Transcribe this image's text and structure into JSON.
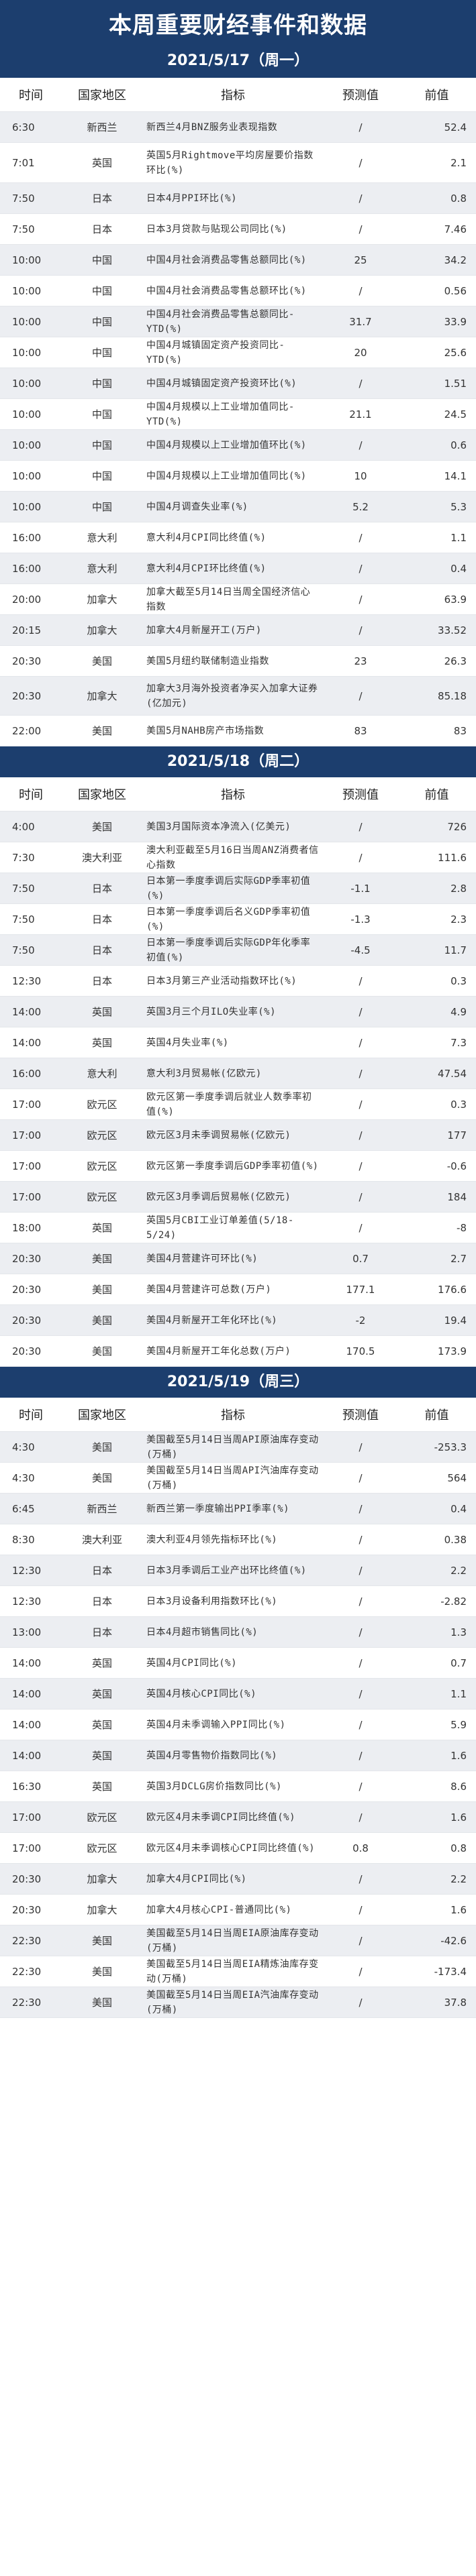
{
  "title": "本周重要财经事件和数据",
  "columns": [
    "时间",
    "国家地区",
    "指标",
    "预测值",
    "前值"
  ],
  "days": [
    {
      "date": "2021/5/17（周一）",
      "rows": [
        {
          "time": "6:30",
          "region": "新西兰",
          "indicator": "新西兰4月BNZ服务业表现指数",
          "forecast": "/",
          "prev": "52.4",
          "h": 46
        },
        {
          "time": "7:01",
          "region": "英国",
          "indicator": "英国5月Rightmove平均房屋要价指数环比(%)",
          "forecast": "/",
          "prev": "2.1",
          "h": 60
        },
        {
          "time": "7:50",
          "region": "日本",
          "indicator": "日本4月PPI环比(%)",
          "forecast": "/",
          "prev": "0.8",
          "h": 46
        },
        {
          "time": "7:50",
          "region": "日本",
          "indicator": "日本3月贷款与贴现公司同比(%)",
          "forecast": "/",
          "prev": "7.46",
          "h": 46
        },
        {
          "time": "10:00",
          "region": "中国",
          "indicator": "中国4月社会消费品零售总额同比(%)",
          "forecast": "25",
          "prev": "34.2",
          "h": 46
        },
        {
          "time": "10:00",
          "region": "中国",
          "indicator": "中国4月社会消费品零售总额环比(%)",
          "forecast": "/",
          "prev": "0.56",
          "h": 46
        },
        {
          "time": "10:00",
          "region": "中国",
          "indicator": "中国4月社会消费品零售总额同比-YTD(%)",
          "forecast": "31.7",
          "prev": "33.9",
          "h": 46
        },
        {
          "time": "10:00",
          "region": "中国",
          "indicator": "中国4月城镇固定资产投资同比-YTD(%)",
          "forecast": "20",
          "prev": "25.6",
          "h": 46
        },
        {
          "time": "10:00",
          "region": "中国",
          "indicator": "中国4月城镇固定资产投资环比(%)",
          "forecast": "/",
          "prev": "1.51",
          "h": 46
        },
        {
          "time": "10:00",
          "region": "中国",
          "indicator": "中国4月规模以上工业增加值同比-YTD(%)",
          "forecast": "21.1",
          "prev": "24.5",
          "h": 46
        },
        {
          "time": "10:00",
          "region": "中国",
          "indicator": "中国4月规模以上工业增加值环比(%)",
          "forecast": "/",
          "prev": "0.6",
          "h": 46
        },
        {
          "time": "10:00",
          "region": "中国",
          "indicator": "中国4月规模以上工业增加值同比(%)",
          "forecast": "10",
          "prev": "14.1",
          "h": 46
        },
        {
          "time": "10:00",
          "region": "中国",
          "indicator": "中国4月调查失业率(%)",
          "forecast": "5.2",
          "prev": "5.3",
          "h": 46
        },
        {
          "time": "16:00",
          "region": "意大利",
          "indicator": "意大利4月CPI同比终值(%)",
          "forecast": "/",
          "prev": "1.1",
          "h": 46
        },
        {
          "time": "16:00",
          "region": "意大利",
          "indicator": "意大利4月CPI环比终值(%)",
          "forecast": "/",
          "prev": "0.4",
          "h": 46
        },
        {
          "time": "20:00",
          "region": "加拿大",
          "indicator": "加拿大截至5月14日当周全国经济信心指数",
          "forecast": "/",
          "prev": "63.9",
          "h": 46
        },
        {
          "time": "20:15",
          "region": "加拿大",
          "indicator": "加拿大4月新屋开工(万户)",
          "forecast": "/",
          "prev": "33.52",
          "h": 46
        },
        {
          "time": "20:30",
          "region": "美国",
          "indicator": "美国5月纽约联储制造业指数",
          "forecast": "23",
          "prev": "26.3",
          "h": 46
        },
        {
          "time": "20:30",
          "region": "加拿大",
          "indicator": "加拿大3月海外投资者净买入加拿大证券(亿加元)",
          "forecast": "/",
          "prev": "85.18",
          "h": 58
        },
        {
          "time": "22:00",
          "region": "美国",
          "indicator": "美国5月NAHB房产市场指数",
          "forecast": "83",
          "prev": "83",
          "h": 46
        }
      ]
    },
    {
      "date": "2021/5/18（周二）",
      "rows": [
        {
          "time": "4:00",
          "region": "美国",
          "indicator": "美国3月国际资本净流入(亿美元)",
          "forecast": "/",
          "prev": "726",
          "h": 46
        },
        {
          "time": "7:30",
          "region": "澳大利亚",
          "indicator": "澳大利亚截至5月16日当周ANZ消费者信心指数",
          "forecast": "/",
          "prev": "111.6",
          "h": 46
        },
        {
          "time": "7:50",
          "region": "日本",
          "indicator": "日本第一季度季调后实际GDP季率初值(%)",
          "forecast": "-1.1",
          "prev": "2.8",
          "h": 46
        },
        {
          "time": "7:50",
          "region": "日本",
          "indicator": "日本第一季度季调后名义GDP季率初值(%)",
          "forecast": "-1.3",
          "prev": "2.3",
          "h": 46
        },
        {
          "time": "7:50",
          "region": "日本",
          "indicator": "日本第一季度季调后实际GDP年化季率初值(%)",
          "forecast": "-4.5",
          "prev": "11.7",
          "h": 46
        },
        {
          "time": "12:30",
          "region": "日本",
          "indicator": "日本3月第三产业活动指数环比(%)",
          "forecast": "/",
          "prev": "0.3",
          "h": 46
        },
        {
          "time": "14:00",
          "region": "英国",
          "indicator": "英国3月三个月ILO失业率(%)",
          "forecast": "/",
          "prev": "4.9",
          "h": 46
        },
        {
          "time": "14:00",
          "region": "英国",
          "indicator": "英国4月失业率(%)",
          "forecast": "/",
          "prev": "7.3",
          "h": 46
        },
        {
          "time": "16:00",
          "region": "意大利",
          "indicator": "意大利3月贸易帐(亿欧元)",
          "forecast": "/",
          "prev": "47.54",
          "h": 46
        },
        {
          "time": "17:00",
          "region": "欧元区",
          "indicator": "欧元区第一季度季调后就业人数季率初值(%)",
          "forecast": "/",
          "prev": "0.3",
          "h": 46
        },
        {
          "time": "17:00",
          "region": "欧元区",
          "indicator": "欧元区3月未季调贸易帐(亿欧元)",
          "forecast": "/",
          "prev": "177",
          "h": 46
        },
        {
          "time": "17:00",
          "region": "欧元区",
          "indicator": "欧元区第一季度季调后GDP季率初值(%)",
          "forecast": "/",
          "prev": "-0.6",
          "h": 46
        },
        {
          "time": "17:00",
          "region": "欧元区",
          "indicator": "欧元区3月季调后贸易帐(亿欧元)",
          "forecast": "/",
          "prev": "184",
          "h": 46
        },
        {
          "time": "18:00",
          "region": "英国",
          "indicator": "英国5月CBI工业订单差值(5/18-5/24)",
          "forecast": "/",
          "prev": "-8",
          "h": 46
        },
        {
          "time": "20:30",
          "region": "美国",
          "indicator": "美国4月营建许可环比(%)",
          "forecast": "0.7",
          "prev": "2.7",
          "h": 46
        },
        {
          "time": "20:30",
          "region": "美国",
          "indicator": "美国4月营建许可总数(万户)",
          "forecast": "177.1",
          "prev": "176.6",
          "h": 46
        },
        {
          "time": "20:30",
          "region": "美国",
          "indicator": "美国4月新屋开工年化环比(%)",
          "forecast": "-2",
          "prev": "19.4",
          "h": 46
        },
        {
          "time": "20:30",
          "region": "美国",
          "indicator": "美国4月新屋开工年化总数(万户)",
          "forecast": "170.5",
          "prev": "173.9",
          "h": 46
        }
      ]
    },
    {
      "date": "2021/5/19（周三）",
      "rows": [
        {
          "time": "4:30",
          "region": "美国",
          "indicator": "美国截至5月14日当周API原油库存变动(万桶)",
          "forecast": "/",
          "prev": "-253.3",
          "h": 46
        },
        {
          "time": "4:30",
          "region": "美国",
          "indicator": "美国截至5月14日当周API汽油库存变动(万桶)",
          "forecast": "/",
          "prev": "564",
          "h": 46
        },
        {
          "time": "6:45",
          "region": "新西兰",
          "indicator": "新西兰第一季度输出PPI季率(%)",
          "forecast": "/",
          "prev": "0.4",
          "h": 46
        },
        {
          "time": "8:30",
          "region": "澳大利亚",
          "indicator": "澳大利亚4月领先指标环比(%)",
          "forecast": "/",
          "prev": "0.38",
          "h": 46
        },
        {
          "time": "12:30",
          "region": "日本",
          "indicator": "日本3月季调后工业产出环比终值(%)",
          "forecast": "/",
          "prev": "2.2",
          "h": 46
        },
        {
          "time": "12:30",
          "region": "日本",
          "indicator": "日本3月设备利用指数环比(%)",
          "forecast": "/",
          "prev": "-2.82",
          "h": 46
        },
        {
          "time": "13:00",
          "region": "日本",
          "indicator": "日本4月超市销售同比(%)",
          "forecast": "/",
          "prev": "1.3",
          "h": 46
        },
        {
          "time": "14:00",
          "region": "英国",
          "indicator": "英国4月CPI同比(%)",
          "forecast": "/",
          "prev": "0.7",
          "h": 46
        },
        {
          "time": "14:00",
          "region": "英国",
          "indicator": "英国4月核心CPI同比(%)",
          "forecast": "/",
          "prev": "1.1",
          "h": 46
        },
        {
          "time": "14:00",
          "region": "英国",
          "indicator": "英国4月未季调输入PPI同比(%)",
          "forecast": "/",
          "prev": "5.9",
          "h": 46
        },
        {
          "time": "14:00",
          "region": "英国",
          "indicator": "英国4月零售物价指数同比(%)",
          "forecast": "/",
          "prev": "1.6",
          "h": 46
        },
        {
          "time": "16:30",
          "region": "英国",
          "indicator": "英国3月DCLG房价指数同比(%)",
          "forecast": "/",
          "prev": "8.6",
          "h": 46
        },
        {
          "time": "17:00",
          "region": "欧元区",
          "indicator": "欧元区4月未季调CPI同比终值(%)",
          "forecast": "/",
          "prev": "1.6",
          "h": 46
        },
        {
          "time": "17:00",
          "region": "欧元区",
          "indicator": "欧元区4月未季调核心CPI同比终值(%)",
          "forecast": "0.8",
          "prev": "0.8",
          "h": 46
        },
        {
          "time": "20:30",
          "region": "加拿大",
          "indicator": "加拿大4月CPI同比(%)",
          "forecast": "/",
          "prev": "2.2",
          "h": 46
        },
        {
          "time": "20:30",
          "region": "加拿大",
          "indicator": "加拿大4月核心CPI-普通同比(%)",
          "forecast": "/",
          "prev": "1.6",
          "h": 46
        },
        {
          "time": "22:30",
          "region": "美国",
          "indicator": "美国截至5月14日当周EIA原油库存变动(万桶)",
          "forecast": "/",
          "prev": "-42.6",
          "h": 46
        },
        {
          "time": "22:30",
          "region": "美国",
          "indicator": "美国截至5月14日当周EIA精炼油库存变动(万桶)",
          "forecast": "/",
          "prev": "-173.4",
          "h": 46
        },
        {
          "time": "22:30",
          "region": "美国",
          "indicator": "美国截至5月14日当周EIA汽油库存变动(万桶)",
          "forecast": "/",
          "prev": "37.8",
          "h": 46
        }
      ]
    }
  ]
}
